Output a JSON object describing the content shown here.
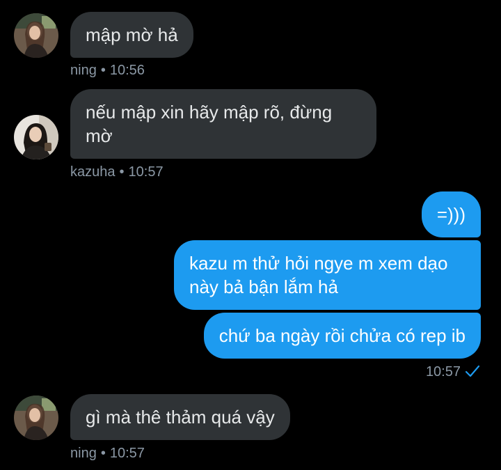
{
  "colors": {
    "background": "#000000",
    "incoming_bubble": "#2f3336",
    "outgoing_bubble": "#1d9bf0",
    "meta_text": "#8b98a5",
    "read_check": "#1d9bf0"
  },
  "messages": [
    {
      "sender": "ning",
      "text": "mập mờ hả",
      "time": "10:56",
      "separator": "•",
      "avatar_icon": "ning-avatar"
    },
    {
      "sender": "kazuha",
      "text": "nếu mập xin hãy mập rõ, đừng\nmờ",
      "time": "10:57",
      "separator": "•",
      "avatar_icon": "kazuha-avatar"
    },
    {
      "sender": "me",
      "text": "=)))"
    },
    {
      "sender": "me",
      "text": "kazu m thử hỏi ngye m xem dạo\nnày bả bận lắm hả"
    },
    {
      "sender": "me",
      "text": "chứ ba ngày rồi chửa có rep ib"
    },
    {
      "sender": "ning",
      "text": "gì mà thê thảm quá vậy",
      "time": "10:57",
      "separator": "•",
      "avatar_icon": "ning-avatar"
    }
  ],
  "outgoing_meta": {
    "time": "10:57",
    "status_icon": "read-check-icon"
  }
}
